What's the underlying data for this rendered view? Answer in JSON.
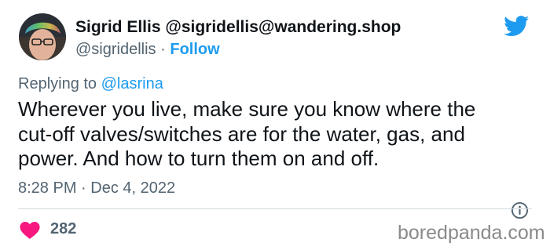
{
  "tweet": {
    "author": {
      "display_name": "Sigrid Ellis @sigridellis@wandering.shop",
      "handle": "@sigridellis",
      "separator": "·",
      "follow_label": "Follow"
    },
    "reply": {
      "prefix": "Replying to",
      "mention": "@lasrina"
    },
    "text_lines": [
      "Wherever you live, make sure you know where the",
      "cut-off valves/switches are for the water, gas, and",
      "power. And how to turn them on and off."
    ],
    "timestamp": "8:28 PM · Dec 4, 2022",
    "like_count": "282"
  },
  "watermark": "boredpanda.com",
  "colors": {
    "twitter_blue": "#1d9bf0",
    "heart_pink": "#f91880",
    "secondary_text": "#536471",
    "divider": "#cfd9de"
  },
  "icons": {
    "brand": "twitter-bird-icon",
    "info": "info-icon",
    "like": "heart-icon"
  }
}
